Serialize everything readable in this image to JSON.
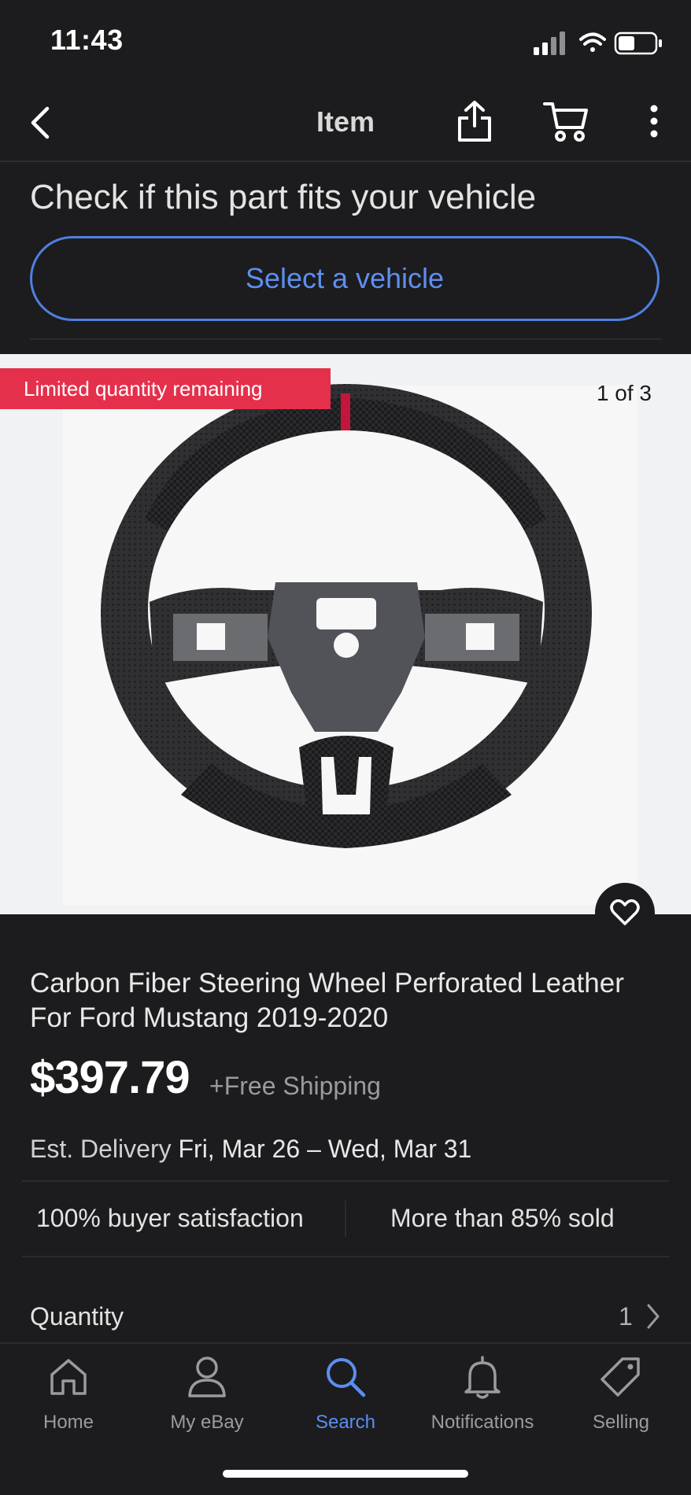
{
  "status_bar": {
    "time": "11:43"
  },
  "nav": {
    "title": "Item"
  },
  "fitment": {
    "heading": "Check if this part fits your vehicle",
    "select_label": "Select a vehicle"
  },
  "gallery": {
    "badge": "Limited quantity remaining",
    "counter": "1 of 3"
  },
  "item": {
    "title": "Carbon Fiber Steering Wheel Perforated Leather For Ford Mustang 2019-2020",
    "price": "$397.79",
    "shipping": "+Free Shipping",
    "delivery_label": "Est. Delivery",
    "delivery_date": "Fri, Mar 26 – Wed, Mar 31"
  },
  "stats": {
    "satisfaction": "100% buyer satisfaction",
    "sold": "More than 85% sold"
  },
  "quantity": {
    "label": "Quantity",
    "value": "1"
  },
  "tabs": [
    {
      "label": "Home",
      "icon": "home-icon"
    },
    {
      "label": "My eBay",
      "icon": "person-icon"
    },
    {
      "label": "Search",
      "icon": "search-icon"
    },
    {
      "label": "Notifications",
      "icon": "bell-icon"
    },
    {
      "label": "Selling",
      "icon": "tag-icon"
    }
  ],
  "colors": {
    "accent": "#5b8ef0",
    "badge": "#e5304b",
    "background": "#1c1c1e"
  }
}
